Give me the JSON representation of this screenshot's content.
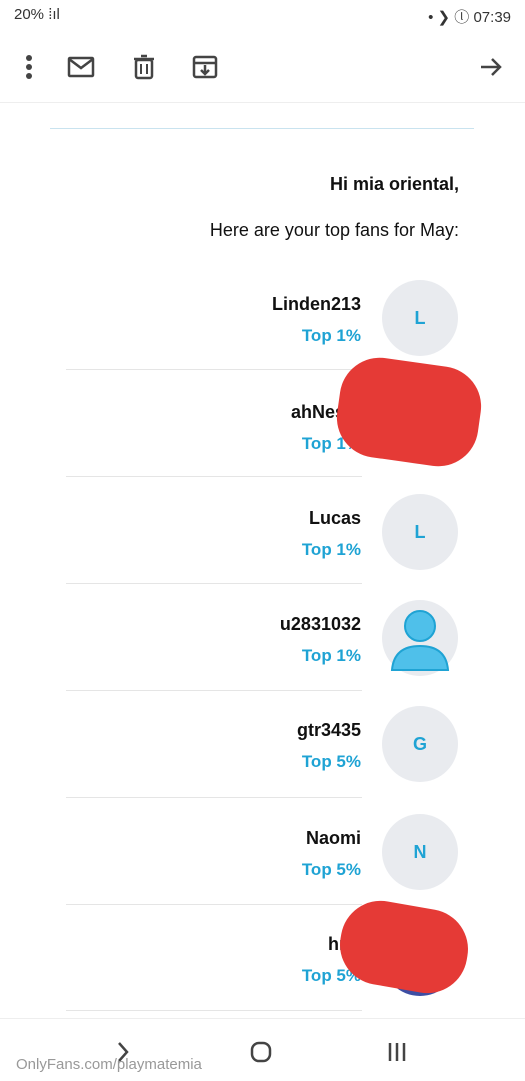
{
  "status_bar": {
    "left_text": "20% ⁞ıl",
    "right_text": "• ❯ ⓛ 07:39"
  },
  "toolbar": {
    "icons": [
      "more-vert-icon",
      "mail-icon",
      "delete-icon",
      "archive-icon",
      "forward-arrow-icon"
    ]
  },
  "email": {
    "greeting": "Hi mia oriental,",
    "subtitle": "Here are your top fans for May:",
    "fans": [
      {
        "name": "Linden213",
        "rank": "Top 1%",
        "initial": "L"
      },
      {
        "name": "ahNesta",
        "rank": "Top 1%",
        "initial": ""
      },
      {
        "name": "Lucas",
        "rank": "Top 1%",
        "initial": "L"
      },
      {
        "name": "u2831032",
        "rank": "Top 1%",
        "initial": ""
      },
      {
        "name": "gtr3435",
        "rank": "Top 5%",
        "initial": "G"
      },
      {
        "name": "Naomi",
        "rank": "Top 5%",
        "initial": "N"
      },
      {
        "name": "hris",
        "rank": "Top 5%",
        "initial": ""
      }
    ]
  },
  "footer": {
    "watermark": "OnlyFans.com/playmatemia"
  },
  "colors": {
    "accent": "#1fa3d4",
    "redaction": "#e53a36",
    "avatar_bg": "#e9ebef"
  }
}
